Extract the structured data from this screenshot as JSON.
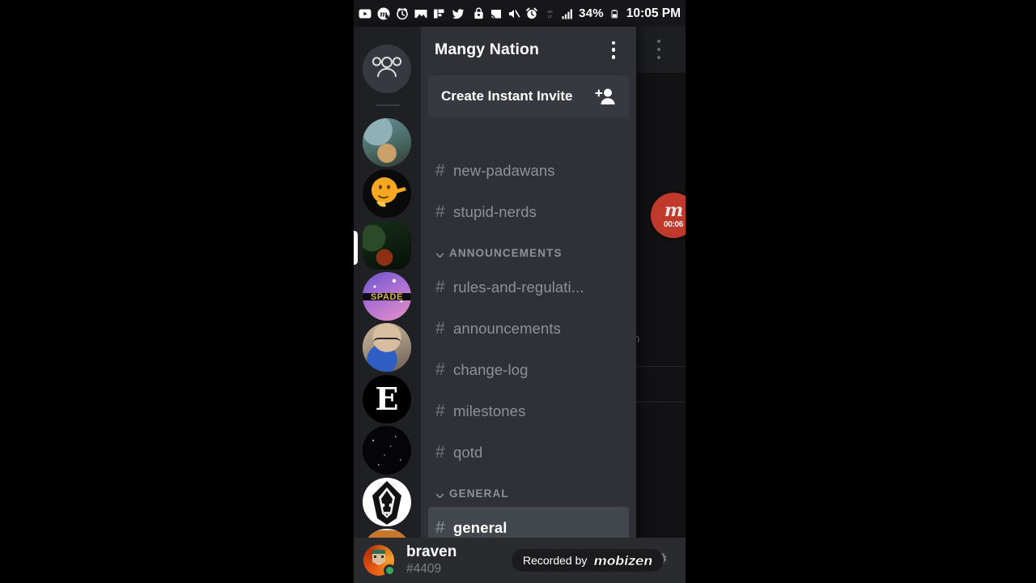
{
  "status_bar": {
    "left_icons": [
      "youtube-icon",
      "mobizen-icon",
      "clock-icon",
      "gallery-icon",
      "flipboard-icon",
      "twitter-icon"
    ],
    "right_icons": [
      "vpn-key-icon",
      "cast-icon",
      "mute-icon",
      "alarm-icon",
      "sim-icon",
      "signal-icon"
    ],
    "battery_percent": "34%",
    "battery_icon": "battery-icon",
    "clock": "10:05 PM"
  },
  "background_screen": {
    "overflow_menu": "overflow-menu-icon",
    "partial_text_right": "n",
    "partial_text_left": "n"
  },
  "mobizen_bubble": {
    "logo": "m",
    "timer": "00:06"
  },
  "server_rail": {
    "home_icon": "friends-icon",
    "servers": [
      {
        "name": "server-cat-photo",
        "type": "circle"
      },
      {
        "name": "server-thinking-emoji",
        "type": "circle"
      },
      {
        "name": "server-dark-photo",
        "type": "squircle"
      },
      {
        "name": "server-spade",
        "type": "circle",
        "label": "SPADE"
      },
      {
        "name": "server-person-photo",
        "type": "circle"
      },
      {
        "name": "server-letter-e",
        "type": "circle",
        "label": "E"
      },
      {
        "name": "server-starfield",
        "type": "circle"
      },
      {
        "name": "server-mask-art",
        "type": "circle"
      },
      {
        "name": "server-person-hat",
        "type": "circle"
      }
    ]
  },
  "panel": {
    "guild_name": "Mangy Nation",
    "guild_menu_icon": "overflow-menu-icon",
    "invite": {
      "label": "Create Instant Invite",
      "icon": "add-person-icon"
    },
    "channels": [
      {
        "kind": "channel",
        "name": "new-padawans",
        "active": false
      },
      {
        "kind": "channel",
        "name": "stupid-nerds",
        "active": false
      },
      {
        "kind": "category",
        "name": "ANNOUNCEMENTS",
        "collapse_icon": "chevron-down-icon"
      },
      {
        "kind": "channel",
        "name": "rules-and-regulati...",
        "active": false
      },
      {
        "kind": "channel",
        "name": "announcements",
        "active": false
      },
      {
        "kind": "channel",
        "name": "change-log",
        "active": false
      },
      {
        "kind": "channel",
        "name": "milestones",
        "active": false
      },
      {
        "kind": "channel",
        "name": "qotd",
        "active": false
      },
      {
        "kind": "category",
        "name": "GENERAL",
        "collapse_icon": "chevron-down-icon"
      },
      {
        "kind": "channel",
        "name": "general",
        "active": true
      }
    ],
    "hash_glyph": "#"
  },
  "user_bar": {
    "username": "braven",
    "discriminator": "#4409",
    "status": "online",
    "avatar": "user-avatar",
    "actions": [
      "microphone-icon",
      "settings-gear-icon"
    ]
  },
  "watermark": {
    "text": "Recorded by",
    "logo": "mobizen"
  },
  "colors": {
    "panel_bg": "#2f3136",
    "rail_bg": "#1e2024",
    "userbar_bg": "#292b2f",
    "active_channel_bg": "#42464d",
    "channel_text": "#8e9297",
    "accent_red": "#c0392b",
    "online_green": "#3ba55d"
  }
}
